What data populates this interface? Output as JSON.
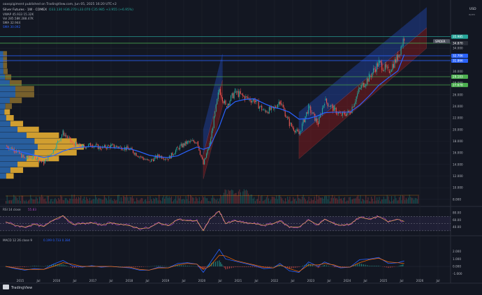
{
  "header": {
    "publisher_line": "oaxspigiment published on TradingView.com, Jun 05, 2025 16:20 UTC+2",
    "symbol_line": "Silver Futures · 1W · COMEX",
    "ohlc": "O33.130 H36.270 L33.070 C35.985 +3.955 (+6.95%)",
    "vwap": "VWAP 45.933  15.32K",
    "vol": "Vol 285.58K  288.47K",
    "sma1": "SMA 32.944",
    "sma2": "SMA 30.092"
  },
  "currency": "USD",
  "currency_sub": "apex",
  "price_axis": {
    "ticks": [
      "36.000",
      "34.000",
      "32.000",
      "30.000",
      "28.000",
      "26.000",
      "24.000",
      "22.000",
      "20.000",
      "18.000",
      "16.000",
      "14.000",
      "12.000",
      "10.000",
      "8.000"
    ],
    "levels": [
      {
        "label": "35.985",
        "value": 35.985,
        "color": "#26a69a"
      },
      {
        "label": "34.870",
        "value": 34.87,
        "color": "#2a2e39"
      },
      {
        "label": "32.706",
        "value": 32.706,
        "color": "#2962ff"
      },
      {
        "label": "31.866",
        "value": 31.866,
        "color": "#2962ff"
      },
      {
        "label": "29.103",
        "value": 29.103,
        "color": "#4caf50"
      },
      {
        "label": "27.678",
        "value": 27.678,
        "color": "#4caf50"
      }
    ],
    "flag": "SPIDER"
  },
  "time_axis": [
    "2015",
    "Jul",
    "2016",
    "Jul",
    "2017",
    "Jul",
    "2018",
    "Jul",
    "2019",
    "Jul",
    "2020",
    "Jul",
    "2021",
    "Jul",
    "2022",
    "Jul",
    "2023",
    "Jul",
    "2024",
    "Jul",
    "2025",
    "Jul",
    "2026",
    "Jul"
  ],
  "rsi": {
    "label": "RSI 14 close",
    "value": "55.83",
    "ticks": [
      "80.00",
      "60.00",
      "40.00"
    ]
  },
  "macd": {
    "label": "MACD 12 26 close 9",
    "value": "0.199  0.733  0.384",
    "ticks": [
      "2.000",
      "1.000",
      "0.000",
      "-1.000"
    ]
  },
  "watermark": "TradingView",
  "colors": {
    "up": "#26a69a",
    "down": "#ef5350",
    "sma_blue": "#2962ff",
    "channel_blue": "#2962ff",
    "channel_red": "#b71c1c",
    "vp_up": "#f2b632",
    "vp_down": "#2d6bb4"
  },
  "chart_data": {
    "type": "candlestick",
    "title": "Silver Futures · 1W · COMEX",
    "ylim": [
      7.5,
      37.5
    ],
    "x": [
      "2015-01",
      "2015-04",
      "2015-07",
      "2015-10",
      "2016-01",
      "2016-04",
      "2016-07",
      "2016-10",
      "2017-01",
      "2017-04",
      "2017-07",
      "2017-10",
      "2018-01",
      "2018-04",
      "2018-07",
      "2018-10",
      "2019-01",
      "2019-04",
      "2019-07",
      "2019-10",
      "2020-01",
      "2020-03",
      "2020-05",
      "2020-08",
      "2020-10",
      "2021-01",
      "2021-04",
      "2021-07",
      "2021-10",
      "2022-01",
      "2022-03",
      "2022-06",
      "2022-09",
      "2022-12",
      "2023-03",
      "2023-05",
      "2023-08",
      "2023-10",
      "2024-01",
      "2024-04",
      "2024-07",
      "2024-10",
      "2025-01",
      "2025-04",
      "2025-06"
    ],
    "close": [
      17.2,
      16.5,
      15.0,
      15.4,
      14.2,
      16.5,
      19.5,
      17.6,
      17.0,
      17.4,
      16.8,
      17.2,
      17.0,
      16.6,
      15.4,
      14.5,
      15.5,
      15.0,
      16.8,
      17.8,
      18.0,
      14.0,
      17.5,
      27.0,
      24.0,
      26.5,
      25.5,
      25.0,
      23.2,
      23.5,
      25.0,
      21.0,
      19.2,
      23.8,
      21.0,
      25.0,
      23.5,
      22.5,
      23.0,
      27.0,
      29.0,
      31.5,
      30.0,
      32.5,
      35.985
    ],
    "sma": [
      16.8,
      16.4,
      16.0,
      15.6,
      15.2,
      15.5,
      16.3,
      16.8,
      17.0,
      17.1,
      17.0,
      16.9,
      16.8,
      16.7,
      16.2,
      15.6,
      15.3,
      15.2,
      15.5,
      16.3,
      17.0,
      16.6,
      17.0,
      20.5,
      23.5,
      24.8,
      25.2,
      25.3,
      24.5,
      23.8,
      23.6,
      23.0,
      21.8,
      21.9,
      22.4,
      22.9,
      23.0,
      23.0,
      23.0,
      24.2,
      25.8,
      27.6,
      28.9,
      30.1,
      32.9
    ],
    "price_levels": [
      35.985,
      34.87,
      32.706,
      31.866,
      29.103,
      27.678
    ],
    "channels": [
      {
        "name": "",
        "from_date": "2020-03",
        "to_date": "2020-09",
        "lower_from": 11.5,
        "lower_to": 24.0,
        "upper_from": 20.0,
        "upper_to": 33.0
      },
      {
        "name": "",
        "from_date": "2022-09",
        "to_date": "2026-01",
        "lower_from": 15.0,
        "lower_to": 34.0,
        "upper_from": 23.0,
        "upper_to": 41.0
      }
    ],
    "rsi_ylim": [
      20,
      90
    ],
    "rsi": [
      55,
      45,
      40,
      48,
      42,
      60,
      72,
      48,
      50,
      52,
      46,
      52,
      48,
      44,
      36,
      38,
      52,
      44,
      62,
      58,
      58,
      30,
      62,
      85,
      50,
      58,
      52,
      50,
      45,
      50,
      58,
      40,
      40,
      60,
      46,
      62,
      50,
      45,
      48,
      68,
      62,
      70,
      55,
      62,
      55.83
    ],
    "macd_ylim": [
      -1.5,
      3.0
    ],
    "macd": [
      0.0,
      -0.3,
      -0.5,
      -0.3,
      -0.4,
      0.3,
      0.8,
      0.1,
      -0.1,
      0.1,
      -0.1,
      0.0,
      -0.1,
      -0.2,
      -0.5,
      -0.5,
      -0.1,
      -0.2,
      0.4,
      0.5,
      0.3,
      -0.8,
      0.4,
      2.3,
      1.0,
      0.7,
      0.4,
      0.1,
      -0.3,
      -0.2,
      0.4,
      -0.6,
      -0.8,
      0.6,
      0.0,
      0.6,
      0.1,
      -0.2,
      -0.1,
      0.9,
      1.0,
      1.2,
      0.4,
      0.5,
      0.733
    ],
    "signal": [
      0.0,
      -0.2,
      -0.4,
      -0.4,
      -0.4,
      0.0,
      0.5,
      0.3,
      0.0,
      0.0,
      0.0,
      0.0,
      -0.1,
      -0.1,
      -0.4,
      -0.5,
      -0.2,
      -0.2,
      0.2,
      0.4,
      0.3,
      -0.4,
      0.0,
      1.5,
      1.4,
      0.8,
      0.5,
      0.2,
      -0.1,
      -0.2,
      0.2,
      -0.3,
      -0.7,
      0.2,
      0.2,
      0.4,
      0.2,
      -0.1,
      -0.1,
      0.5,
      0.9,
      1.1,
      0.6,
      0.5,
      0.384
    ]
  }
}
